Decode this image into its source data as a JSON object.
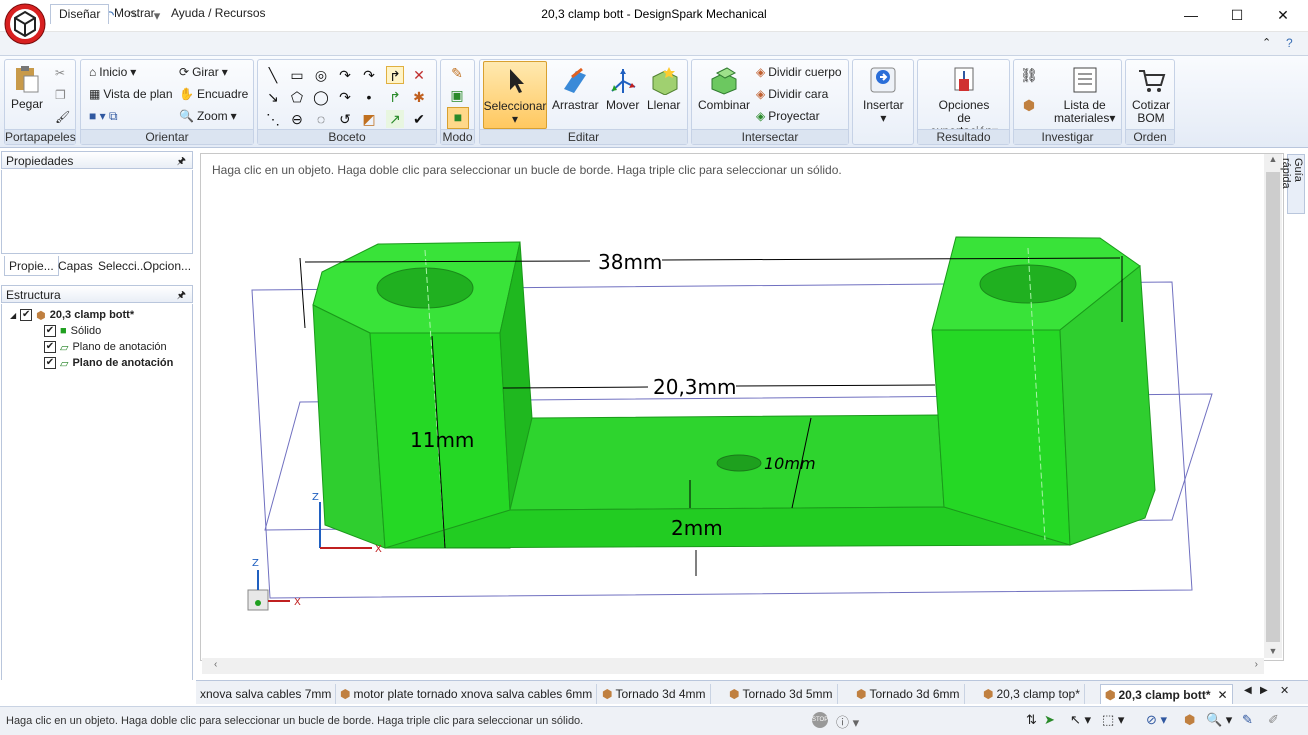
{
  "window": {
    "title": "20,3 clamp bott - DesignSpark Mechanical"
  },
  "qat": {
    "icons": [
      "open-icon",
      "save-icon",
      "undo-icon",
      "redo-icon",
      "customize-icon"
    ]
  },
  "ribbon_tabs": [
    "Diseñar",
    "Mostrar",
    "Ayuda / Recursos"
  ],
  "groups": {
    "portapapeles": {
      "label": "Portapapeles",
      "pegar": "Pegar"
    },
    "orientar": {
      "label": "Orientar",
      "inicio": "Inicio",
      "girar": "Girar",
      "vista_plan": "Vista de plan",
      "encuadre": "Encuadre",
      "zoom": "Zoom"
    },
    "boceto": {
      "label": "Boceto"
    },
    "modo": {
      "label": "Modo"
    },
    "editar": {
      "label": "Editar",
      "seleccionar": "Seleccionar",
      "arrastrar": "Arrastrar",
      "mover": "Mover",
      "llenar": "Llenar"
    },
    "intersectar": {
      "label": "Intersectar",
      "combinar": "Combinar",
      "dividir_cuerpo": "Dividir cuerpo",
      "dividir_cara": "Dividir cara",
      "proyectar": "Proyectar"
    },
    "insertar": {
      "label": "Insertar"
    },
    "resultado": {
      "label": "Resultado",
      "opciones1": "Opciones",
      "opciones2": "de exportación"
    },
    "investigar": {
      "label": "Investigar",
      "lista1": "Lista de",
      "lista2": "materiales"
    },
    "orden": {
      "label": "Orden",
      "cotizar1": "Cotizar",
      "cotizar2": "BOM"
    }
  },
  "panels": {
    "propiedades": "Propiedades",
    "tabs": [
      "Propie...",
      "Capas",
      "Selecci...",
      "Opcion..."
    ],
    "estructura": "Estructura",
    "tree": [
      "20,3 clamp bott*",
      "Sólido",
      "Plano de anotación",
      "Plano de anotación"
    ]
  },
  "side_tab": "Guía rápida",
  "viewport": {
    "hint": "Haga clic en un objeto. Haga doble clic para seleccionar un bucle de borde. Haga triple clic para seleccionar un sólido.",
    "dims": {
      "d38": "38mm",
      "d203": "20,3mm",
      "d11": "11mm",
      "d10": "10mm",
      "d2": "2mm"
    },
    "axes": {
      "z": "Z",
      "x": "X"
    }
  },
  "doc_tabs": [
    "xnova salva cables 7mm",
    "motor plate tornado xnova salva cables 6mm",
    "Tornado 3d 4mm",
    "Tornado 3d 5mm",
    "Tornado 3d 6mm",
    "20,3 clamp top*",
    "20,3 clamp bott*"
  ],
  "status": {
    "text": "Haga clic en un objeto. Haga doble clic para seleccionar un bucle de borde. Haga triple clic para seleccionar un sólido."
  },
  "colors": {
    "solid": "#22dd22",
    "ribbon_hl": "#ffd88a"
  }
}
